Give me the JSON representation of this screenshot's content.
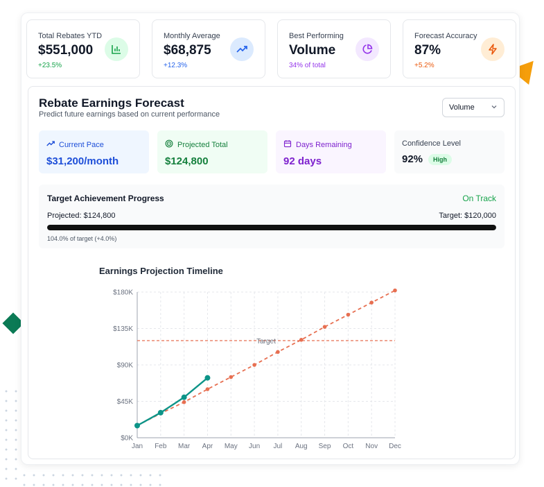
{
  "stats": [
    {
      "label": "Total Rebates YTD",
      "value": "$551,000",
      "sub": "+23.5%",
      "sub_color": "#16a34a",
      "icon": "bar-chart-icon",
      "icon_bg": "#dcfce7",
      "icon_color": "#16a34a"
    },
    {
      "label": "Monthly Average",
      "value": "$68,875",
      "sub": "+12.3%",
      "sub_color": "#2563eb",
      "icon": "trending-up-icon",
      "icon_bg": "#dbeafe",
      "icon_color": "#2563eb"
    },
    {
      "label": "Best Performing",
      "value": "Volume",
      "sub": "34% of total",
      "sub_color": "#9333ea",
      "icon": "pie-chart-icon",
      "icon_bg": "#f3e8ff",
      "icon_color": "#9333ea"
    },
    {
      "label": "Forecast Accuracy",
      "value": "87%",
      "sub": "+5.2%",
      "sub_color": "#ea580c",
      "icon": "zap-icon",
      "icon_bg": "#ffedd5",
      "icon_color": "#ea580c"
    }
  ],
  "forecast": {
    "title": "Rebate Earnings Forecast",
    "subtitle": "Predict future earnings based on current performance",
    "select_value": "Volume"
  },
  "metrics": [
    {
      "label": "Current Pace",
      "value": "$31,200/month",
      "icon": "trending-up-icon",
      "bg": "#eff6ff",
      "color": "#1d4ed8"
    },
    {
      "label": "Projected Total",
      "value": "$124,800",
      "icon": "target-icon",
      "bg": "#f0fdf4",
      "color": "#15803d"
    },
    {
      "label": "Days Remaining",
      "value": "92 days",
      "icon": "calendar-icon",
      "bg": "#faf5ff",
      "color": "#7e22ce"
    },
    {
      "label": "Confidence Level",
      "value": "92%",
      "badge": "High",
      "icon": "",
      "bg": "#f9fafb",
      "color": "#111827"
    }
  ],
  "progress": {
    "title": "Target Achievement Progress",
    "status": "On Track",
    "projected_label": "Projected: $124,800",
    "target_label": "Target: $120,000",
    "percent": 100,
    "note": "104.0% of target (+4.0%)"
  },
  "chart_data": {
    "type": "line",
    "title": "Earnings Projection Timeline",
    "categories": [
      "Jan",
      "Feb",
      "Mar",
      "Apr",
      "May",
      "Jun",
      "Jul",
      "Aug",
      "Sep",
      "Oct",
      "Nov",
      "Dec"
    ],
    "y_ticks": [
      "$0K",
      "$45K",
      "$90K",
      "$135K",
      "$180K"
    ],
    "ylim": [
      0,
      180000
    ],
    "series": [
      {
        "values": [
          15000,
          31000,
          50000,
          74000,
          null,
          null,
          null,
          null,
          null,
          null,
          null,
          null
        ],
        "color": "#0d9488",
        "style": "solid"
      },
      {
        "values": [
          15000,
          30000,
          44000,
          60000,
          75000,
          90000,
          106000,
          121000,
          137000,
          152000,
          167000,
          182000
        ],
        "color": "#e76f51",
        "style": "dashed"
      }
    ],
    "target": {
      "value": 120000,
      "label": "Target",
      "color": "#e76f51"
    },
    "grid": true
  }
}
